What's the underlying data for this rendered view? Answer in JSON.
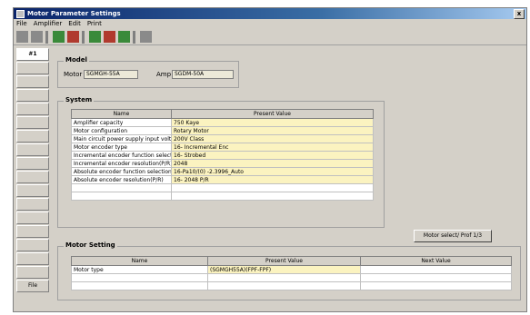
{
  "window": {
    "title": "Motor Parameter Settings",
    "close_label": "x"
  },
  "menu": [
    "File",
    "Amplifier",
    "Edit",
    "Print"
  ],
  "sidebar": {
    "items": [
      "#1",
      "",
      "",
      "",
      "",
      "",
      "",
      "",
      "",
      "",
      "",
      "",
      "",
      "",
      "",
      "",
      "",
      "File"
    ]
  },
  "model": {
    "legend": "Model",
    "motor_label": "Motor",
    "motor_value": "SGMGH-55A",
    "amp_label": "Amp",
    "amp_value": "SGDM-50A"
  },
  "system": {
    "legend": "System",
    "columns": [
      "Name",
      "Present Value"
    ],
    "rows": [
      {
        "name": "Amplifier capacity",
        "value": "750 Kaye"
      },
      {
        "name": "Motor configuration",
        "value": "Rotary Motor"
      },
      {
        "name": "Main circuit power supply input voltage",
        "value": "200V Class"
      },
      {
        "name": "Motor encoder type",
        "value": "16- Incremental Enc"
      },
      {
        "name": "Incremental encoder function selection",
        "value": "16- Strobed"
      },
      {
        "name": "Incremental encoder resolution(P/R)",
        "value": "2048"
      },
      {
        "name": "Absolute encoder function selection",
        "value": "16-Pa10/(0) -2.3996_Auto"
      },
      {
        "name": "Absolute encoder resolution(P/R)",
        "value": "16- 2048 P/R"
      }
    ]
  },
  "apply_button": "Motor select/ Prof 1/3",
  "motor_setting": {
    "legend": "Motor Setting",
    "columns": [
      "Name",
      "Present Value",
      "Next Value"
    ],
    "rows": [
      {
        "name": "Motor type",
        "present": "(SGMGH55A)(FPF-FPF)",
        "next": ""
      }
    ]
  },
  "colors": {
    "value_bg": "#fbf3c0",
    "titlebar": "#0a246a"
  }
}
